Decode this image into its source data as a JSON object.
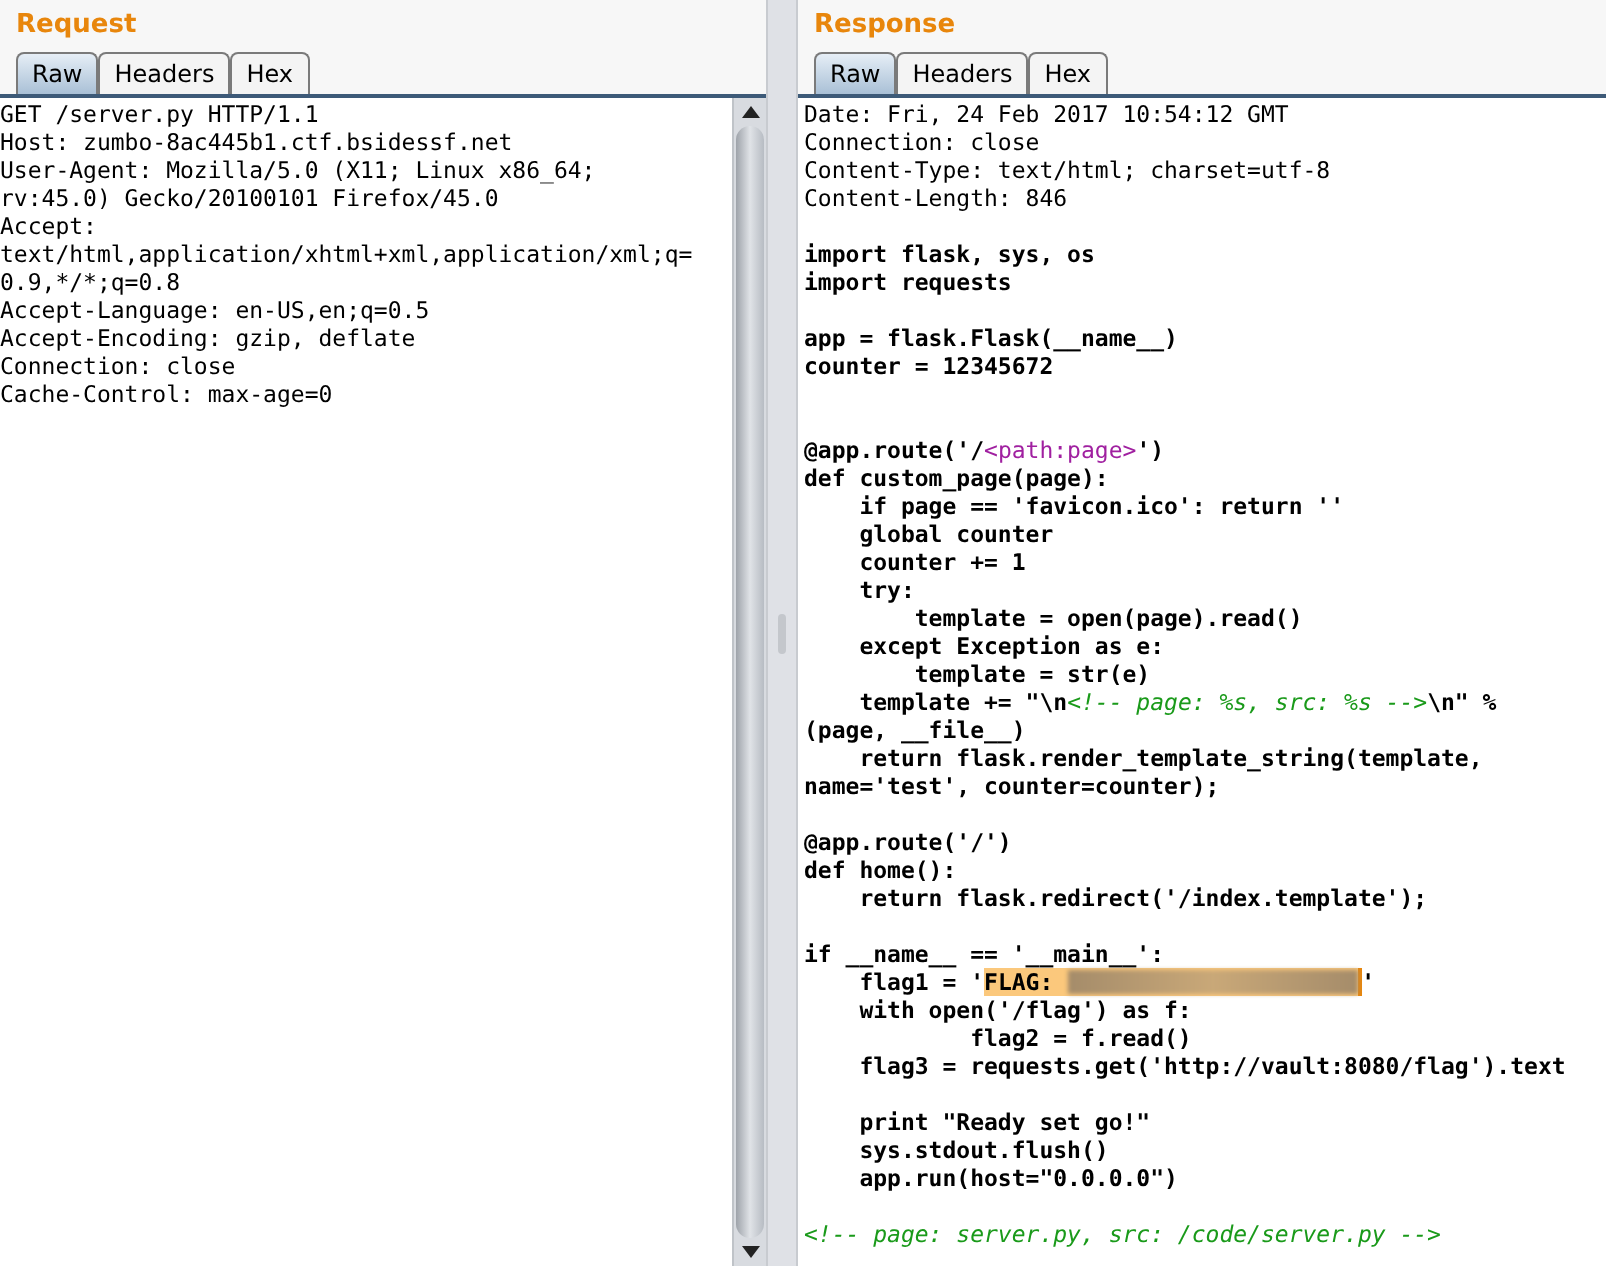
{
  "request": {
    "title": "Request",
    "tabs": [
      {
        "label": "Raw",
        "selected": true
      },
      {
        "label": "Headers",
        "selected": false
      },
      {
        "label": "Hex",
        "selected": false
      }
    ],
    "lines": [
      "GET /server.py HTTP/1.1",
      "Host: zumbo-8ac445b1.ctf.bsidessf.net",
      "User-Agent: Mozilla/5.0 (X11; Linux x86_64;",
      "rv:45.0) Gecko/20100101 Firefox/45.0",
      "Accept:",
      "text/html,application/xhtml+xml,application/xml;q=",
      "0.9,*/*;q=0.8",
      "Accept-Language: en-US,en;q=0.5",
      "Accept-Encoding: gzip, deflate",
      "Connection: close",
      "Cache-Control: max-age=0"
    ]
  },
  "response": {
    "title": "Response",
    "tabs": [
      {
        "label": "Raw",
        "selected": true
      },
      {
        "label": "Headers",
        "selected": false
      },
      {
        "label": "Hex",
        "selected": false
      }
    ],
    "lines": [
      {
        "kind": "header",
        "segments": [
          {
            "kind": "plain",
            "text": "Date: Fri, 24 Feb 2017 10:54:12 GMT"
          }
        ]
      },
      {
        "kind": "header",
        "segments": [
          {
            "kind": "plain",
            "text": "Connection: close"
          }
        ]
      },
      {
        "kind": "header",
        "segments": [
          {
            "kind": "plain",
            "text": "Content-Type: text/html; charset=utf-8"
          }
        ]
      },
      {
        "kind": "header",
        "segments": [
          {
            "kind": "plain",
            "text": "Content-Length: 846"
          }
        ]
      },
      {
        "kind": "blank"
      },
      {
        "kind": "code",
        "segments": [
          {
            "kind": "plain",
            "text": "import flask, sys, os"
          }
        ]
      },
      {
        "kind": "code",
        "segments": [
          {
            "kind": "plain",
            "text": "import requests"
          }
        ]
      },
      {
        "kind": "blank"
      },
      {
        "kind": "code",
        "segments": [
          {
            "kind": "plain",
            "text": "app = flask.Flask(__name__)"
          }
        ]
      },
      {
        "kind": "code",
        "segments": [
          {
            "kind": "plain",
            "text": "counter = 12345672"
          }
        ]
      },
      {
        "kind": "blank"
      },
      {
        "kind": "blank"
      },
      {
        "kind": "code",
        "segments": [
          {
            "kind": "plain",
            "text": "@app.route('/"
          },
          {
            "kind": "tag",
            "text": "<path:page>"
          },
          {
            "kind": "plain",
            "text": "')"
          }
        ]
      },
      {
        "kind": "code",
        "segments": [
          {
            "kind": "plain",
            "text": "def custom_page(page):"
          }
        ]
      },
      {
        "kind": "code",
        "segments": [
          {
            "kind": "plain",
            "text": "    if page == 'favicon.ico': return ''"
          }
        ]
      },
      {
        "kind": "code",
        "segments": [
          {
            "kind": "plain",
            "text": "    global counter"
          }
        ]
      },
      {
        "kind": "code",
        "segments": [
          {
            "kind": "plain",
            "text": "    counter += 1"
          }
        ]
      },
      {
        "kind": "code",
        "segments": [
          {
            "kind": "plain",
            "text": "    try:"
          }
        ]
      },
      {
        "kind": "code",
        "segments": [
          {
            "kind": "plain",
            "text": "        template = open(page).read()"
          }
        ]
      },
      {
        "kind": "code",
        "segments": [
          {
            "kind": "plain",
            "text": "    except Exception as e:"
          }
        ]
      },
      {
        "kind": "code",
        "segments": [
          {
            "kind": "plain",
            "text": "        template = str(e)"
          }
        ]
      },
      {
        "kind": "code",
        "segments": [
          {
            "kind": "plain",
            "text": "    template += \"\\n"
          },
          {
            "kind": "comment",
            "text": "<!-- page: %s, src: %s -->"
          },
          {
            "kind": "plain",
            "text": "\\n\" %"
          }
        ]
      },
      {
        "kind": "code",
        "segments": [
          {
            "kind": "plain",
            "text": "(page, __file__)"
          }
        ]
      },
      {
        "kind": "code",
        "segments": [
          {
            "kind": "plain",
            "text": "    return flask.render_template_string(template,"
          }
        ]
      },
      {
        "kind": "code",
        "segments": [
          {
            "kind": "plain",
            "text": "name='test', counter=counter);"
          }
        ]
      },
      {
        "kind": "blank"
      },
      {
        "kind": "code",
        "segments": [
          {
            "kind": "plain",
            "text": "@app.route('/')"
          }
        ]
      },
      {
        "kind": "code",
        "segments": [
          {
            "kind": "plain",
            "text": "def home():"
          }
        ]
      },
      {
        "kind": "code",
        "segments": [
          {
            "kind": "plain",
            "text": "    return flask.redirect('/index.template');"
          }
        ]
      },
      {
        "kind": "blank"
      },
      {
        "kind": "code",
        "segments": [
          {
            "kind": "plain",
            "text": "if __name__ == '__main__':"
          }
        ]
      },
      {
        "kind": "code",
        "segments": [
          {
            "kind": "plain",
            "text": "    flag1 = '"
          },
          {
            "kind": "redacted",
            "text": "FLAG: "
          },
          {
            "kind": "plain",
            "text": "'"
          }
        ]
      },
      {
        "kind": "code",
        "segments": [
          {
            "kind": "plain",
            "text": "    with open('/flag') as f:"
          }
        ]
      },
      {
        "kind": "code",
        "segments": [
          {
            "kind": "plain",
            "text": "            flag2 = f.read()"
          }
        ]
      },
      {
        "kind": "code",
        "segments": [
          {
            "kind": "plain",
            "text": "    flag3 = requests.get('http://vault:8080/flag').text"
          }
        ]
      },
      {
        "kind": "blank"
      },
      {
        "kind": "code",
        "segments": [
          {
            "kind": "plain",
            "text": "    print \"Ready set go!\""
          }
        ]
      },
      {
        "kind": "code",
        "segments": [
          {
            "kind": "plain",
            "text": "    sys.stdout.flush()"
          }
        ]
      },
      {
        "kind": "code",
        "segments": [
          {
            "kind": "plain",
            "text": "    app.run(host=\"0.0.0.0\")"
          }
        ]
      },
      {
        "kind": "blank"
      },
      {
        "kind": "code",
        "segments": [
          {
            "kind": "comment",
            "text": "<!-- page: server.py, src: /code/server.py -->"
          }
        ]
      }
    ]
  }
}
